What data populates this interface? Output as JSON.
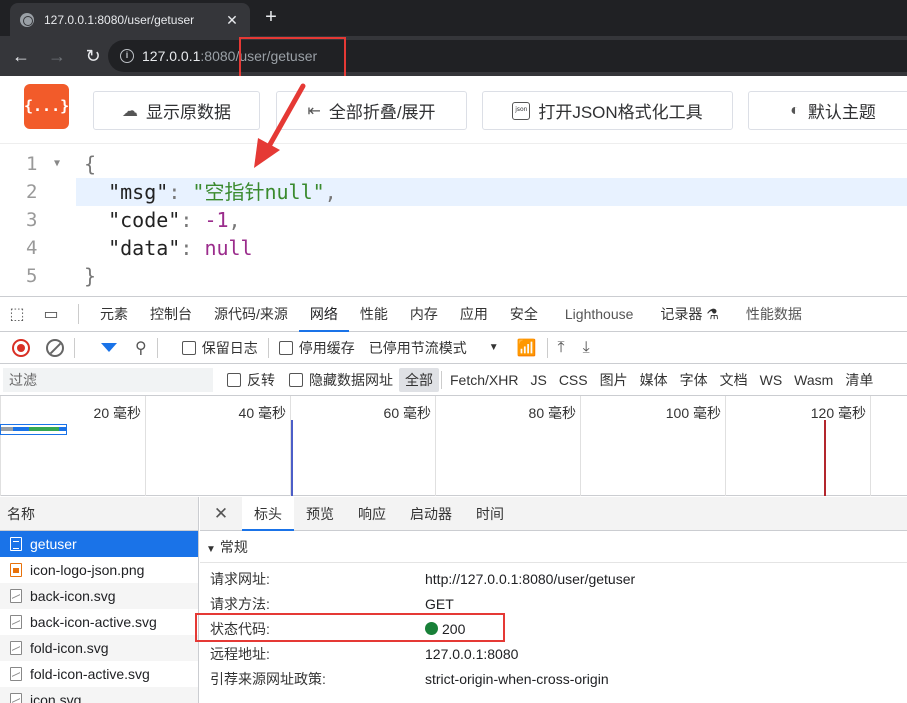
{
  "browser": {
    "tab_title": "127.0.0.1:8080/user/getuser",
    "new_tab_symbol": "+",
    "close_symbol": "✕",
    "url_host": "127.0.0.1",
    "url_port": ":8080",
    "url_path": "/user/getuser"
  },
  "json_toolbar": {
    "logo_text": "{...}",
    "show_raw": "显示原数据",
    "fold_all": "全部折叠/展开",
    "open_formatter": "打开JSON格式化工具",
    "default_theme": "默认主题",
    "json_icon_text": "json"
  },
  "code": {
    "line_numbers": [
      "1",
      "2",
      "3",
      "4",
      "5"
    ],
    "lines": {
      "open": "{",
      "msg_key": "\"msg\"",
      "msg_value": "\"空指针null\"",
      "code_key": "\"code\"",
      "code_value": "-1",
      "data_key": "\"data\"",
      "data_value": "null",
      "close": "}"
    }
  },
  "devtools": {
    "tabs": [
      "元素",
      "控制台",
      "源代码/来源",
      "网络",
      "性能",
      "内存",
      "应用",
      "安全",
      "Lighthouse",
      "记录器 ⚗",
      "性能数据"
    ],
    "active_tab": "网络",
    "toolbar": {
      "preserve_log": "保留日志",
      "disable_cache": "停用缓存",
      "throttling": "已停用节流模式"
    },
    "filter": {
      "placeholder": "过滤",
      "invert": "反转",
      "hide_data_urls": "隐藏数据网址",
      "types": [
        "全部",
        "Fetch/XHR",
        "JS",
        "CSS",
        "图片",
        "媒体",
        "字体",
        "文档",
        "WS",
        "Wasm",
        "清单"
      ]
    },
    "timeline_labels": [
      "20 毫秒",
      "40 毫秒",
      "60 毫秒",
      "80 毫秒",
      "100 毫秒",
      "120 毫秒"
    ],
    "request_list": {
      "header": "名称",
      "items": [
        "getuser",
        "icon-logo-json.png",
        "back-icon.svg",
        "back-icon-active.svg",
        "fold-icon.svg",
        "fold-icon-active.svg",
        "icon.svg"
      ]
    },
    "detail": {
      "tabs": [
        "标头",
        "预览",
        "响应",
        "启动器",
        "时间"
      ],
      "active_tab": "标头",
      "section": "常规",
      "rows": [
        {
          "key": "请求网址:",
          "value": "http://127.0.0.1:8080/user/getuser"
        },
        {
          "key": "请求方法:",
          "value": "GET"
        },
        {
          "key": "状态代码:",
          "value": "200"
        },
        {
          "key": "远程地址:",
          "value": "127.0.0.1:8080"
        },
        {
          "key": "引荐来源网址政策:",
          "value": "strict-origin-when-cross-origin"
        }
      ]
    }
  },
  "colors": {
    "accent_blue": "#1a73e8",
    "annotation_red": "#e53935",
    "status_green": "#188038",
    "logo_orange": "#f25b2a"
  }
}
